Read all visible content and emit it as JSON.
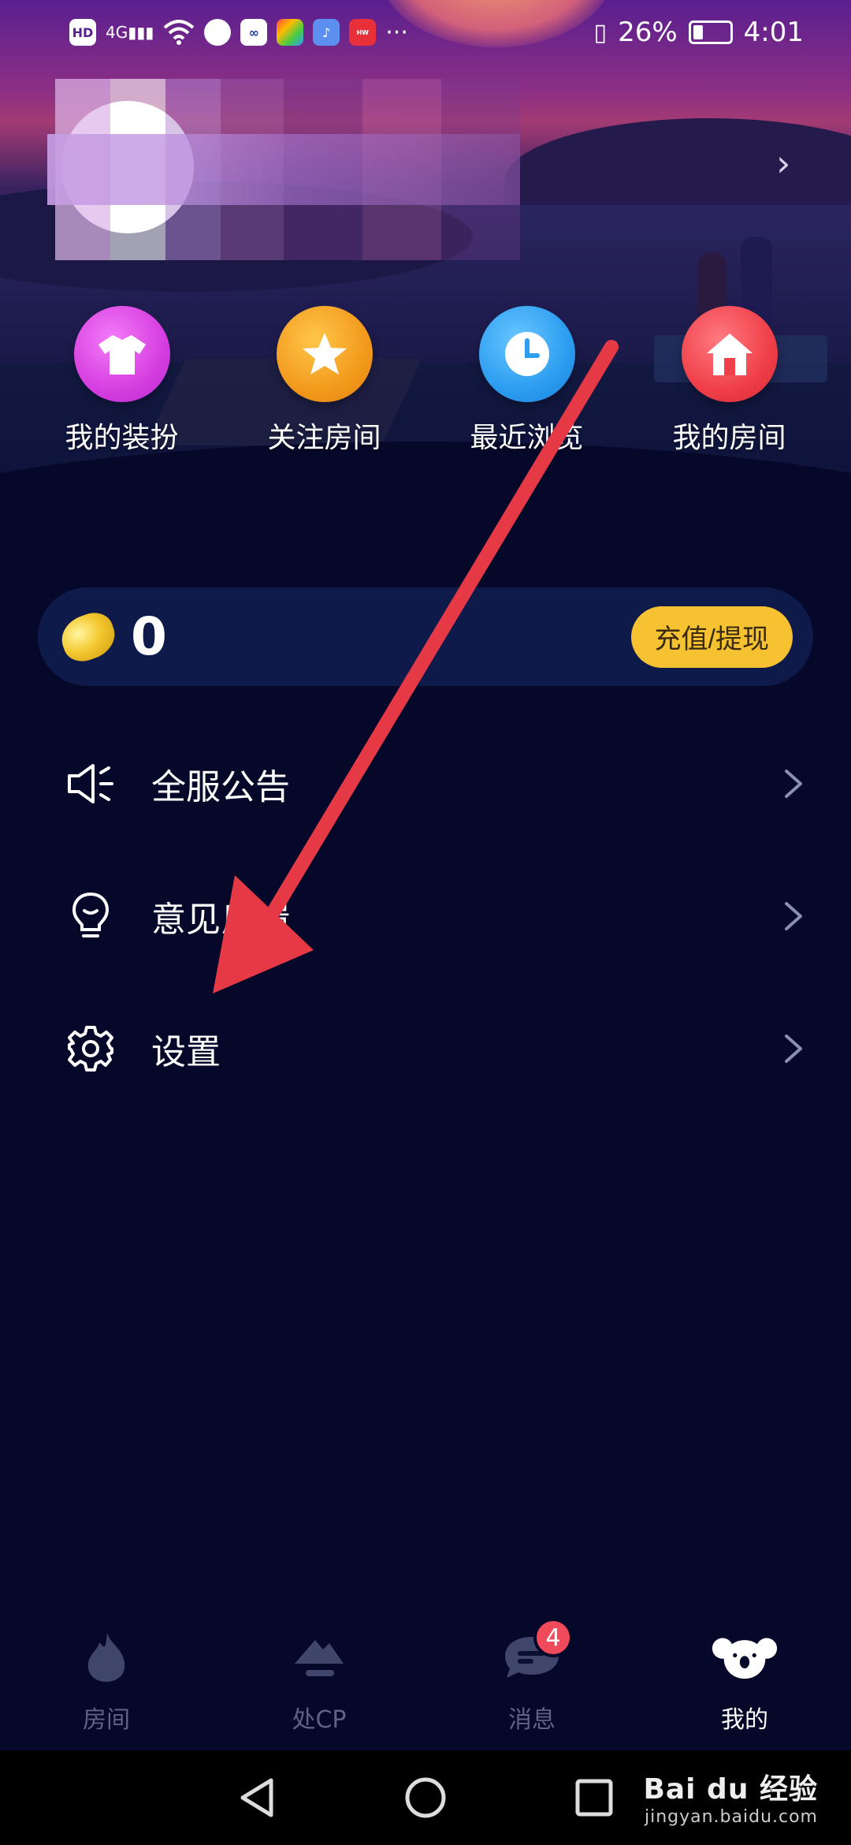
{
  "status_bar": {
    "left_icons": [
      "hd-icon",
      "signal-4g-icon",
      "wifi-icon",
      "chat-bubble-icon",
      "infinity-app-icon",
      "colorful-app-icon",
      "music-app-icon",
      "huawei-app-icon",
      "more-dots-icon"
    ],
    "battery": "26%",
    "time": "4:01"
  },
  "quick_actions": [
    {
      "label": "我的装扮",
      "icon": "tshirt-icon",
      "color": "#d63ee0"
    },
    {
      "label": "关注房间",
      "icon": "star-icon",
      "color": "#f29a1c"
    },
    {
      "label": "最近浏览",
      "icon": "clock-icon",
      "color": "#2c9df0"
    },
    {
      "label": "我的房间",
      "icon": "house-icon",
      "color": "#ef3f48"
    }
  ],
  "wallet": {
    "balance": "0",
    "recharge_label": "充值/提现"
  },
  "menu": [
    {
      "label": "全服公告",
      "icon": "speaker-icon"
    },
    {
      "label": "意见反馈",
      "icon": "lightbulb-icon"
    },
    {
      "label": "设置",
      "icon": "gear-icon"
    }
  ],
  "tabs": [
    {
      "label": "房间",
      "icon": "flame-icon"
    },
    {
      "label": "处CP",
      "icon": "mountain-icon"
    },
    {
      "label": "消息",
      "icon": "message-icon",
      "badge": "4"
    },
    {
      "label": "我的",
      "icon": "koala-icon",
      "active": true
    }
  ],
  "watermark": {
    "brand": "Bai du 经验",
    "url": "jingyan.baidu.com"
  },
  "colors": {
    "background": "#050829",
    "wallet_bg": "#0e1a4a",
    "recharge": "#f6c232",
    "annotation_arrow": "#e63946"
  }
}
